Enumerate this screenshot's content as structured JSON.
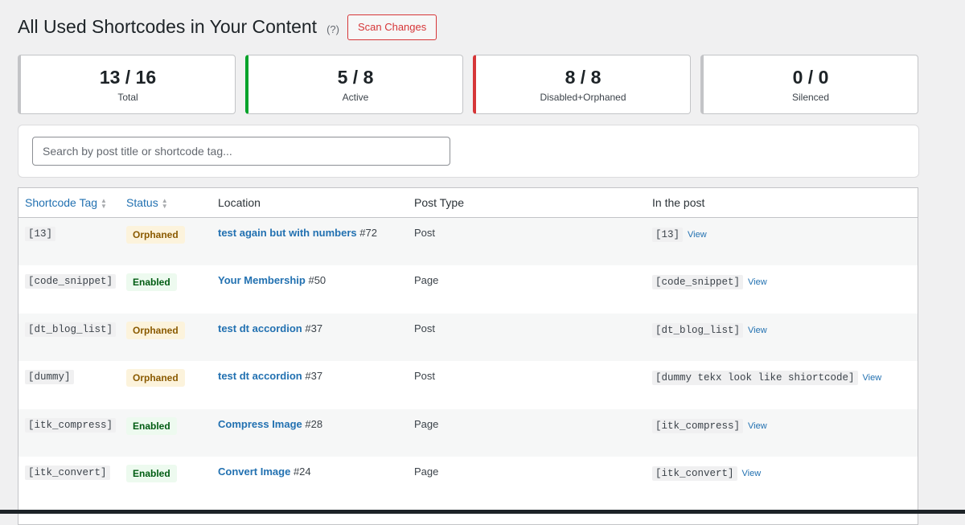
{
  "header": {
    "title": "All Used Shortcodes in Your Content",
    "help": "(?)",
    "scan_button": "Scan Changes"
  },
  "cards": [
    {
      "value": "13 / 16",
      "label": "Total"
    },
    {
      "value": "5 / 8",
      "label": "Active"
    },
    {
      "value": "8 / 8",
      "label": "Disabled+Orphaned"
    },
    {
      "value": "0 / 0",
      "label": "Silenced"
    }
  ],
  "search": {
    "placeholder": "Search by post title or shortcode tag...",
    "value": ""
  },
  "table": {
    "columns": [
      "Shortcode Tag",
      "Status",
      "Location",
      "Post Type",
      "In the post"
    ],
    "rows": [
      {
        "tag": "[13]",
        "status": "Orphaned",
        "title": "test again but with numbers",
        "id": "#72",
        "type": "Post",
        "in_post": "[13]",
        "view": "View"
      },
      {
        "tag": "[code_snippet]",
        "status": "Enabled",
        "title": "Your Membership",
        "id": "#50",
        "type": "Page",
        "in_post": "[code_snippet]",
        "view": "View"
      },
      {
        "tag": "[dt_blog_list]",
        "status": "Orphaned",
        "title": "test dt accordion",
        "id": "#37",
        "type": "Post",
        "in_post": "[dt_blog_list]",
        "view": "View"
      },
      {
        "tag": "[dummy]",
        "status": "Orphaned",
        "title": "test dt accordion",
        "id": "#37",
        "type": "Post",
        "in_post": "[dummy tekx look like shiortcode]",
        "view": "View"
      },
      {
        "tag": "[itk_compress]",
        "status": "Enabled",
        "title": "Compress Image",
        "id": "#28",
        "type": "Page",
        "in_post": "[itk_compress]",
        "view": "View"
      },
      {
        "tag": "[itk_convert]",
        "status": "Enabled",
        "title": "Convert Image",
        "id": "#24",
        "type": "Page",
        "in_post": "[itk_convert]",
        "view": "View"
      }
    ]
  }
}
